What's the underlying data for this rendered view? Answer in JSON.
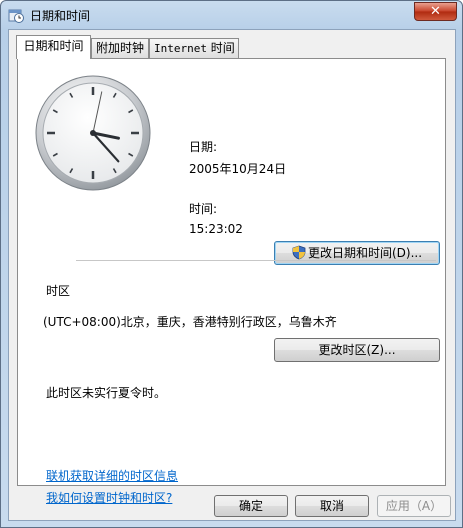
{
  "window": {
    "title": "日期和时间",
    "close_glyph": "✕"
  },
  "tabs": [
    {
      "label": "日期和时间",
      "active": true
    },
    {
      "label": "附加时钟",
      "active": false
    },
    {
      "label_latin": "Internet",
      "label_cn": " 时间",
      "active": false
    }
  ],
  "datetime": {
    "date_label": "日期:",
    "date_value": "2005年10月24日",
    "time_label": "间:",
    "time_prefix": "时",
    "time_value": "15:23:02",
    "change_button": "更改日期和时间(D)..."
  },
  "clock": {
    "hour": 15,
    "minute": 23,
    "second": 2
  },
  "timezone": {
    "section_label": "时区",
    "value": "(UTC+08:00)北京，重庆，香港特别行政区，乌鲁木齐",
    "change_button": "更改时区(Z)...",
    "dst_note": "此时区未实行夏令时。"
  },
  "links": {
    "details": "联机获取详细的时区信息",
    "help": "我如何设置时钟和时区?"
  },
  "footer": {
    "ok": "确定",
    "cancel": "取消",
    "apply": "应用（A）"
  },
  "icons": {
    "app": "datetime-app-icon",
    "shield": "uac-shield-icon",
    "close": "close-icon"
  },
  "colors": {
    "link": "#0066cc",
    "close": "#c8442c",
    "titlebar": "#b7cfe8"
  }
}
